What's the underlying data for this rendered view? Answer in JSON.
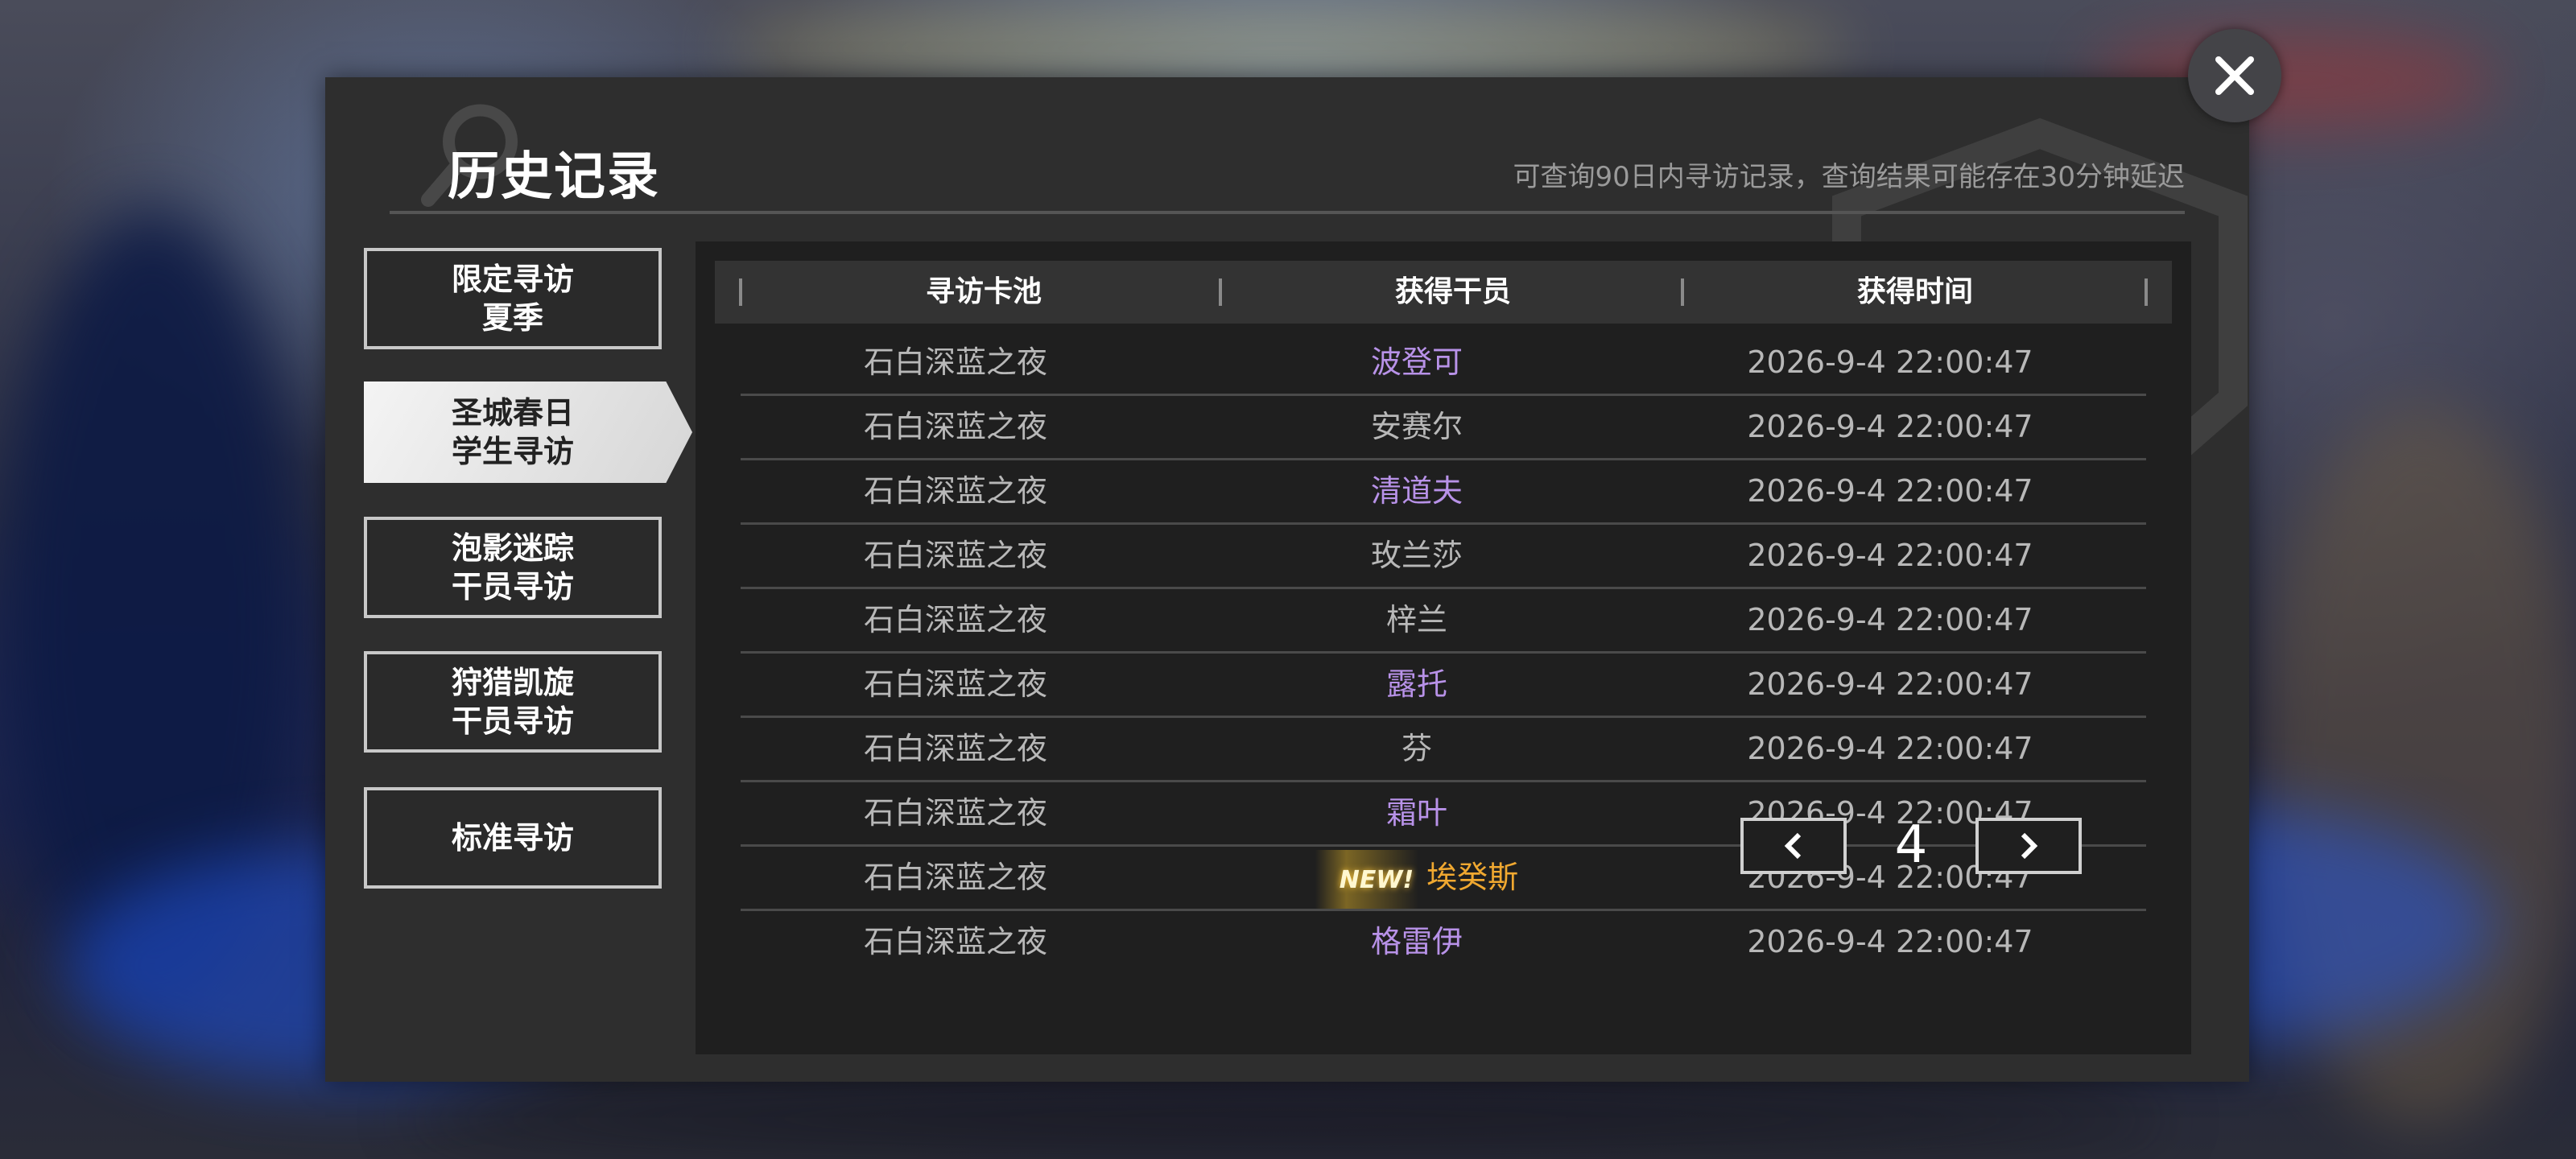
{
  "window": {
    "title": "历史记录",
    "subtitle": "可查询90日内寻访记录，查询结果可能存在30分钟延迟"
  },
  "sidebar": {
    "items": [
      {
        "label": "限定寻访\n夏季",
        "active": false
      },
      {
        "label": "圣城春日\n学生寻访",
        "active": true
      },
      {
        "label": "泡影迷踪\n干员寻访",
        "active": false
      },
      {
        "label": "狩猎凯旋\n干员寻访",
        "active": false
      },
      {
        "label": "标准寻访",
        "active": false
      }
    ]
  },
  "table": {
    "headers": [
      "寻访卡池",
      "获得干员",
      "获得时间"
    ],
    "rows": [
      {
        "pool": "石白深蓝之夜",
        "operator": "波登可",
        "time": "2026-9-4 22:00:47",
        "rarity_color": "purple",
        "new": false
      },
      {
        "pool": "石白深蓝之夜",
        "operator": "安赛尔",
        "time": "2026-9-4 22:00:47",
        "rarity_color": "gray",
        "new": false
      },
      {
        "pool": "石白深蓝之夜",
        "operator": "清道夫",
        "time": "2026-9-4 22:00:47",
        "rarity_color": "purple",
        "new": false
      },
      {
        "pool": "石白深蓝之夜",
        "operator": "玫兰莎",
        "time": "2026-9-4 22:00:47",
        "rarity_color": "gray",
        "new": false
      },
      {
        "pool": "石白深蓝之夜",
        "operator": "梓兰",
        "time": "2026-9-4 22:00:47",
        "rarity_color": "gray",
        "new": false
      },
      {
        "pool": "石白深蓝之夜",
        "operator": "露托",
        "time": "2026-9-4 22:00:47",
        "rarity_color": "purple",
        "new": false
      },
      {
        "pool": "石白深蓝之夜",
        "operator": "芬",
        "time": "2026-9-4 22:00:47",
        "rarity_color": "gray",
        "new": false
      },
      {
        "pool": "石白深蓝之夜",
        "operator": "霜叶",
        "time": "2026-9-4 22:00:47",
        "rarity_color": "purple",
        "new": false
      },
      {
        "pool": "石白深蓝之夜",
        "operator": "埃癸斯",
        "time": "2026-9-4 22:00:47",
        "rarity_color": "gold",
        "new": true
      },
      {
        "pool": "石白深蓝之夜",
        "operator": "格雷伊",
        "time": "2026-9-4 22:00:47",
        "rarity_color": "purple",
        "new": false
      }
    ],
    "new_tag": "NEW!"
  },
  "pager": {
    "page": "4",
    "prev_icon": "chevron-left-icon",
    "next_icon": "chevron-right-icon"
  },
  "colors": {
    "purple": "#b892e8",
    "gray": "#b8b8b8",
    "gold": "#f0a830"
  },
  "icons": {
    "close": "close-icon",
    "search": "search-icon"
  }
}
